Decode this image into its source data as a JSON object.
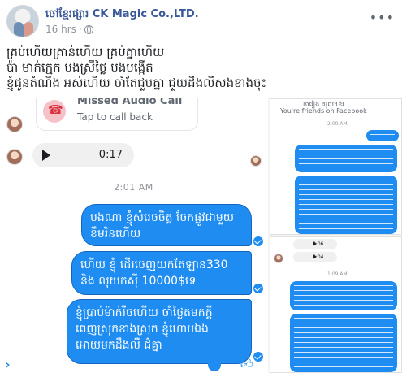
{
  "post": {
    "page_name": "ចៅខ្មែរផ្សារ CK Magic Co.,LTD.",
    "time": "16 hrs",
    "more_label": "•••",
    "caption_lines": [
      "គ្រប់ហើយគ្រាន់ហើយ គ្រប់គ្នាហើយ",
      "ប៉ា មាក់ក្មេក បងស្រីថ្លៃ បងបង្កើត",
      "ខ្ញុំជូនតំណឹង អស់ហើយ ចាំតែជួបគ្នា ជួយដឹងលឺសងខាងចុះ"
    ]
  },
  "chat": {
    "missed_call_title": "Missed Audio Call",
    "missed_call_sub": "Tap to call back",
    "audio_duration": "0:17",
    "timestamp": "2:01 AM",
    "bubbles": [
      [
        "បងណា ខ្ញុំសំរេចចិត្ត ចែកផ្លូវជាមួយ",
        "ខឹមរិនហើយ"
      ],
      [
        "ហើយ ខ្ញុំ ដើរចេញយកតែឡាន330",
        "និង លុយកស៊ី 10000$ទេ"
      ],
      [
        "ខ្ញុំប្រាប់ម៉ាក់រឺចហើយ ចាំថ្ងៃតមកក្ដី",
        "ពេញស្រុកខាងស្រុក ខ្ញុំហោបឯង",
        "អោយមកដឹងលឺ ជំគ្នា"
      ]
    ]
  },
  "collage": {
    "top_panel_header": "ការៀង ងរុល។ខ៊រ",
    "friends_text": "You're friends on Facebook",
    "top_time": "2:00 AM",
    "audio_1": "0:06",
    "audio_2": "0:04",
    "bottom_time": "1:09 AM"
  },
  "colors": {
    "accent": "#1e8cf0",
    "page_link": "#385898",
    "meta_gray": "#90949c"
  }
}
